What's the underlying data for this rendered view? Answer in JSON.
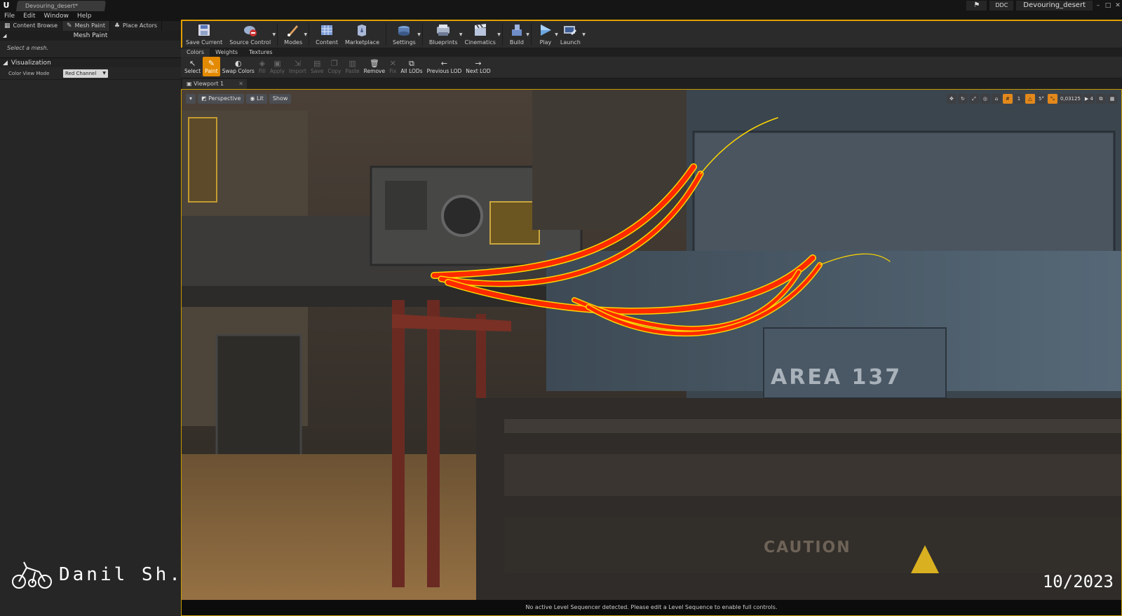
{
  "titlebar": {
    "document_tab": "Devouring_desert*",
    "ddc": "DDC",
    "project_name": "Devouring_desert"
  },
  "menu": [
    "File",
    "Edit",
    "Window",
    "Help"
  ],
  "left_tabs": [
    {
      "label": "Content Browse",
      "icon": "content-browser-icon"
    },
    {
      "label": "Mesh Paint",
      "icon": "brush-icon"
    },
    {
      "label": "Place Actors",
      "icon": "place-actors-icon"
    }
  ],
  "mesh_paint_panel": {
    "header": "Mesh Paint",
    "hint": "Select a mesh.",
    "visualization_header": "Visualization",
    "color_view_mode_label": "Color View Mode",
    "color_view_mode_value": "Red Channel"
  },
  "toolbar": [
    {
      "label": "Save Current",
      "icon": "save-icon",
      "dropdown": false
    },
    {
      "label": "Source Control",
      "icon": "source-control-icon",
      "dropdown": true
    },
    {
      "label": "Modes",
      "icon": "modes-icon",
      "dropdown": true
    },
    {
      "label": "Content",
      "icon": "content-icon",
      "dropdown": false
    },
    {
      "label": "Marketplace",
      "icon": "marketplace-icon",
      "dropdown": false
    },
    {
      "label": "Settings",
      "icon": "settings-icon",
      "dropdown": true
    },
    {
      "label": "Blueprints",
      "icon": "blueprints-icon",
      "dropdown": true
    },
    {
      "label": "Cinematics",
      "icon": "cinematics-icon",
      "dropdown": true
    },
    {
      "label": "Build",
      "icon": "build-icon",
      "dropdown": true
    },
    {
      "label": "Play",
      "icon": "play-icon",
      "dropdown": true
    },
    {
      "label": "Launch",
      "icon": "launch-icon",
      "dropdown": true
    }
  ],
  "mesh_paint_tabs": [
    "Colors",
    "Weights",
    "Textures"
  ],
  "mesh_paint_tools": [
    {
      "label": "Select",
      "icon": "select-icon",
      "state": "on"
    },
    {
      "label": "Paint",
      "icon": "paint-icon",
      "state": "sel"
    },
    {
      "label": "Swap Colors",
      "icon": "swap-colors-icon",
      "state": "on"
    },
    {
      "label": "Fill",
      "icon": "fill-icon",
      "state": "off"
    },
    {
      "label": "Apply",
      "icon": "apply-icon",
      "state": "off"
    },
    {
      "label": "Import",
      "icon": "import-icon",
      "state": "off"
    },
    {
      "label": "Save",
      "icon": "save-icon",
      "state": "off"
    },
    {
      "label": "Copy",
      "icon": "copy-icon",
      "state": "off"
    },
    {
      "label": "Paste",
      "icon": "paste-icon",
      "state": "off"
    },
    {
      "label": "Remove",
      "icon": "remove-icon",
      "state": "on"
    },
    {
      "label": "Fix",
      "icon": "fix-icon",
      "state": "off"
    },
    {
      "label": "All LODs",
      "icon": "all-lods-icon",
      "state": "on"
    },
    {
      "label": "Previous LOD",
      "icon": "previous-lod-icon",
      "state": "on"
    },
    {
      "label": "Next LOD",
      "icon": "next-lod-icon",
      "state": "on"
    }
  ],
  "viewport": {
    "tab_label": "Viewport 1",
    "perspective": "Perspective",
    "lit": "Lit",
    "show": "Show",
    "snap_angle": "5°",
    "scale_snap": "0,03125",
    "camera_speed": "4",
    "status": "No active Level Sequencer detected. Please edit a Level Sequence to enable full controls."
  },
  "scene_text": {
    "area_sign": "AREA 137",
    "caution_sign": "CAUTION"
  },
  "overlay": {
    "signature": "Danil Sh.",
    "date": "10/2023"
  },
  "colors": {
    "accent": "#e38a00",
    "paint_red": "#ff2a00",
    "selection_outline": "#ffd700"
  }
}
